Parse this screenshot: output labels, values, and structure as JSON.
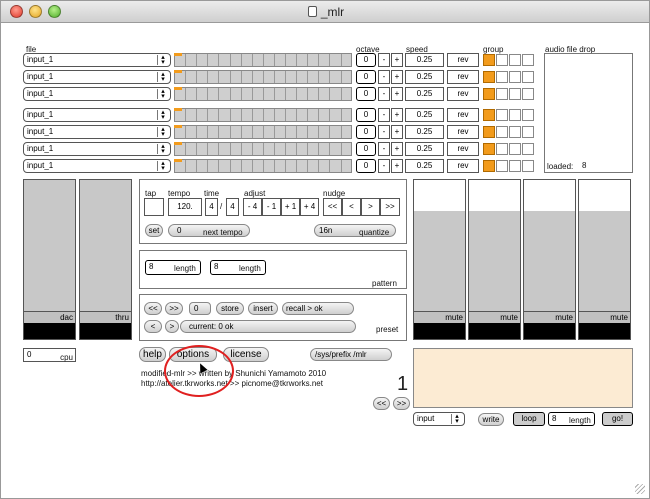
{
  "window": {
    "title": "_mlr"
  },
  "headers": {
    "file": "file",
    "octave": "octave",
    "speed": "speed",
    "group": "group",
    "drop": "audio file drop",
    "loaded_label": "loaded:",
    "loaded_value": "8"
  },
  "tracks": [
    {
      "input": "input_1",
      "octave": "0",
      "speed": "0.25",
      "minus": "-",
      "plus": "+",
      "rev": "rev",
      "group_on": 0
    },
    {
      "input": "input_1",
      "octave": "0",
      "speed": "0.25",
      "minus": "-",
      "plus": "+",
      "rev": "rev",
      "group_on": 0
    },
    {
      "input": "input_1",
      "octave": "0",
      "speed": "0.25",
      "minus": "-",
      "plus": "+",
      "rev": "rev",
      "group_on": 0
    },
    {
      "input": "input_1",
      "octave": "0",
      "speed": "0.25",
      "minus": "-",
      "plus": "+",
      "rev": "rev",
      "group_on": 0
    },
    {
      "input": "input_1",
      "octave": "0",
      "speed": "0.25",
      "minus": "-",
      "plus": "+",
      "rev": "rev",
      "group_on": 0
    },
    {
      "input": "input_1",
      "octave": "0",
      "speed": "0.25",
      "minus": "-",
      "plus": "+",
      "rev": "rev",
      "group_on": 0
    },
    {
      "input": "input_1",
      "octave": "0",
      "speed": "0.25",
      "minus": "-",
      "plus": "+",
      "rev": "rev",
      "group_on": 0
    }
  ],
  "transport": {
    "tap": "tap",
    "tempo": "tempo",
    "time": "time",
    "adjust": "adjust",
    "nudge": "nudge",
    "tempo_value": "120.",
    "time_num": "4",
    "time_sep": "/",
    "time_den": "4",
    "adj": [
      "- 4",
      "- 1",
      "+ 1",
      "+ 4"
    ],
    "nudge_btns": [
      "<<",
      "<",
      ">",
      ">>"
    ],
    "set": "set",
    "next_tempo_value": "0",
    "next_tempo": "next tempo",
    "quantize_value": "16n",
    "quantize": "quantize"
  },
  "pattern": {
    "len1_value": "8",
    "len1": "length",
    "len2_value": "8",
    "len2": "length",
    "label": "pattern"
  },
  "preset": {
    "prev": "<<",
    "next": ">>",
    "num": "0",
    "store": "store",
    "insert": "insert",
    "recall": "recall > ok",
    "back": "<",
    "fwd": ">",
    "current": "current: 0 ok",
    "label": "preset"
  },
  "left_strips": {
    "dac": "dac",
    "thru": "thru"
  },
  "cpu": {
    "value": "0",
    "label": "cpu"
  },
  "mute_labels": [
    "mute",
    "mute",
    "mute",
    "mute"
  ],
  "bottom": {
    "help": "help",
    "options": "options",
    "license": "license",
    "prefix": "/sys/prefix /mlr",
    "credit1": "modified-mlr >> written by Shunichi Yamamoto  2010",
    "credit2": "http://atelier.tkrworks.net >> picnome@tkrworks.net",
    "big_number": "1",
    "nav_prev": "<<",
    "nav_next": ">>"
  },
  "record": {
    "input": "input",
    "write": "write",
    "loop": "loop",
    "length_value": "8",
    "length_label": "length",
    "go": "go!"
  }
}
